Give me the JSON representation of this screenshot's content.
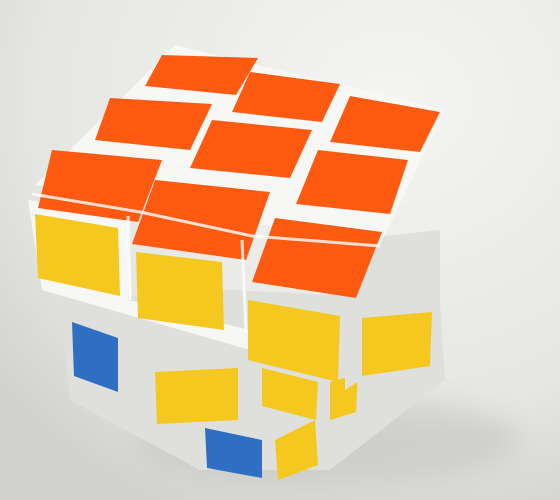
{
  "scene": {
    "subject": "rubiks-cube",
    "colors": {
      "background_light": "#f4f4f2",
      "background_mid": "#e6e6e3",
      "background_shadow": "#d2d2cf",
      "plastic_white": "#f7f7f5",
      "plastic_shade": "#dfdfdc",
      "orange": "#ff5a12",
      "yellow": "#f4c81f",
      "blue": "#2f6fc3"
    }
  }
}
